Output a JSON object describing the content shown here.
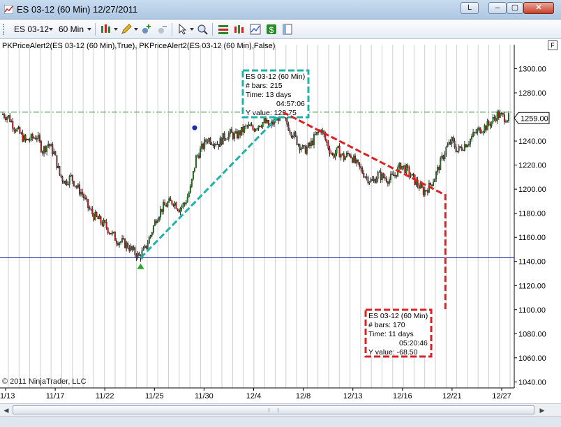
{
  "window": {
    "title": "ES 03-12 (60 Min)  12/27/2011",
    "link_label": "L",
    "min_label": "–",
    "max_label": "▢",
    "close_label": "✕"
  },
  "toolbar": {
    "instrument": "ES 03-12",
    "interval": "60 Min",
    "icons": [
      "bar-type-icon",
      "drawing-pencil-icon",
      "add-indicator-icon",
      "remove-indicator-icon",
      "cursor-icon",
      "zoom-icon",
      "strategy-icon",
      "data-series-icon",
      "chart-properties-icon",
      "order-dollar-icon",
      "template-icon"
    ]
  },
  "chart": {
    "indicator_label": "PKPriceAlert2(ES 03-12 (60 Min),True), PKPriceAlert2(ES 03-12 (60 Min),False)",
    "f_button": "F",
    "copyright": "© 2011 NinjaTrader, LLC",
    "current_price": "1259.00"
  },
  "chart_data": {
    "type": "candlestick",
    "instrument": "ES 03-12",
    "interval": "60 Min",
    "ylim": [
      1035,
      1320
    ],
    "y_ticks": [
      1040,
      1060,
      1080,
      1100,
      1120,
      1140,
      1160,
      1180,
      1200,
      1220,
      1240,
      1260,
      1280,
      1300
    ],
    "y_tick_labels": [
      "1040.00",
      "1060.00",
      "1080.00",
      "1100.00",
      "1120.00",
      "1140.00",
      "1160.00",
      "1180.00",
      "1200.00",
      "1220.00",
      "1240.00",
      "1260.00",
      "1280.00",
      "1300.00"
    ],
    "x_labels": [
      "11/13",
      "11/17",
      "11/22",
      "11/25",
      "11/30",
      "12/4",
      "12/8",
      "12/13",
      "12/16",
      "12/21",
      "12/27"
    ],
    "close_path": [
      [
        0,
        1262
      ],
      [
        4,
        1260
      ],
      [
        8,
        1252
      ],
      [
        12,
        1246
      ],
      [
        16,
        1240
      ],
      [
        20,
        1242
      ],
      [
        24,
        1244
      ],
      [
        28,
        1232
      ],
      [
        32,
        1238
      ],
      [
        36,
        1230
      ],
      [
        40,
        1212
      ],
      [
        44,
        1206
      ],
      [
        48,
        1210
      ],
      [
        52,
        1202
      ],
      [
        56,
        1196
      ],
      [
        60,
        1185
      ],
      [
        64,
        1178
      ],
      [
        68,
        1174
      ],
      [
        72,
        1170
      ],
      [
        76,
        1164
      ],
      [
        80,
        1158
      ],
      [
        84,
        1156
      ],
      [
        88,
        1153
      ],
      [
        92,
        1148
      ],
      [
        96,
        1144
      ],
      [
        100,
        1150
      ],
      [
        104,
        1162
      ],
      [
        108,
        1176
      ],
      [
        112,
        1184
      ],
      [
        116,
        1188
      ],
      [
        120,
        1190
      ],
      [
        124,
        1184
      ],
      [
        128,
        1188
      ],
      [
        132,
        1200
      ],
      [
        136,
        1226
      ],
      [
        140,
        1234
      ],
      [
        144,
        1242
      ],
      [
        148,
        1240
      ],
      [
        152,
        1238
      ],
      [
        156,
        1244
      ],
      [
        160,
        1246
      ],
      [
        164,
        1244
      ],
      [
        168,
        1248
      ],
      [
        172,
        1252
      ],
      [
        176,
        1250
      ],
      [
        180,
        1254
      ],
      [
        184,
        1256
      ],
      [
        188,
        1252
      ],
      [
        192,
        1258
      ],
      [
        196,
        1262
      ],
      [
        200,
        1254
      ],
      [
        204,
        1246
      ],
      [
        208,
        1238
      ],
      [
        212,
        1232
      ],
      [
        216,
        1236
      ],
      [
        220,
        1244
      ],
      [
        224,
        1250
      ],
      [
        228,
        1238
      ],
      [
        232,
        1228
      ],
      [
        236,
        1232
      ],
      [
        240,
        1226
      ],
      [
        244,
        1230
      ],
      [
        248,
        1222
      ],
      [
        252,
        1216
      ],
      [
        256,
        1210
      ],
      [
        260,
        1206
      ],
      [
        264,
        1212
      ],
      [
        268,
        1210
      ],
      [
        272,
        1208
      ],
      [
        276,
        1212
      ],
      [
        280,
        1220
      ],
      [
        284,
        1216
      ],
      [
        288,
        1210
      ],
      [
        292,
        1204
      ],
      [
        296,
        1198
      ],
      [
        300,
        1202
      ],
      [
        304,
        1210
      ],
      [
        308,
        1222
      ],
      [
        312,
        1234
      ],
      [
        316,
        1240
      ],
      [
        320,
        1232
      ],
      [
        324,
        1236
      ],
      [
        328,
        1240
      ],
      [
        332,
        1246
      ],
      [
        336,
        1250
      ],
      [
        340,
        1252
      ],
      [
        344,
        1256
      ],
      [
        348,
        1262
      ],
      [
        352,
        1260
      ],
      [
        356,
        1259
      ]
    ],
    "bar_count": 357,
    "reference_line": 1143,
    "upper_reference_line": 1264,
    "current_price": 1259.0,
    "annotations": [
      {
        "name": "up-measure",
        "color": "#20b2aa",
        "from": [
          97,
          1143
        ],
        "to": [
          197,
          1264
        ],
        "label_title": "ES 03-12 (60 Min)",
        "label_bars": "# bars:   215",
        "label_time": "Time:     13 days",
        "label_time2": "04:57:06",
        "label_y": "Y value:  123.75"
      },
      {
        "name": "down-measure",
        "color": "#e02020",
        "from": [
          197,
          1264
        ],
        "to": [
          310,
          1196
        ],
        "label_title": "ES 03-12 (60 Min)",
        "label_bars": "# bars:   170",
        "label_time": "Time:     11 days",
        "label_time2": "05:20:46",
        "label_y": "Y value:  -68.50"
      }
    ],
    "markers": [
      {
        "name": "up-triangle-marker",
        "bar": 97,
        "price": 1136,
        "color": "#22aa22"
      },
      {
        "name": "blue-dot-marker",
        "bar": 135,
        "price": 1251,
        "color": "#1a2ab0"
      }
    ]
  }
}
